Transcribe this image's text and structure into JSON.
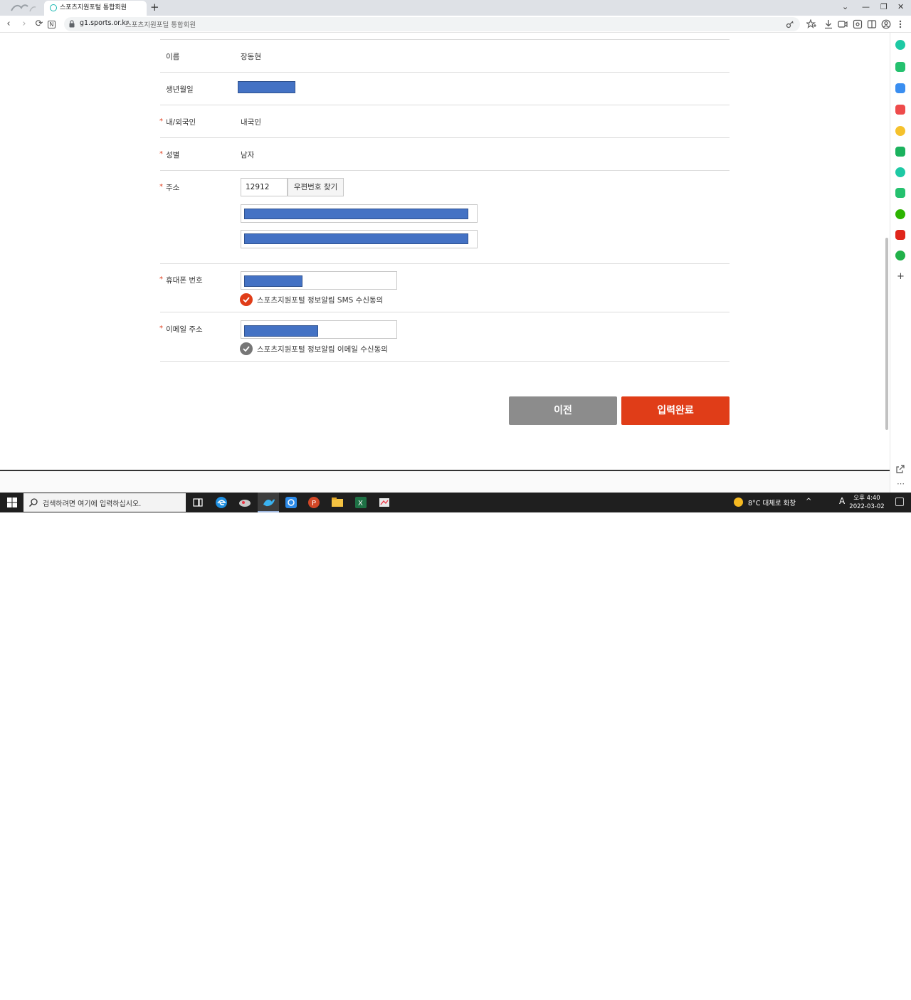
{
  "browser": {
    "tab_title": "스포츠지원포털 통합회원",
    "tab_close": "×",
    "new_tab": "+",
    "url_host": "g1.sports.or.kr",
    "url_title": "스포츠지원포털 통합회원",
    "window_controls": [
      "⌄",
      "—",
      "❐",
      "✕"
    ],
    "nav": {
      "back": "‹",
      "forward": "›",
      "reload": "⟳",
      "n_badge": "N"
    }
  },
  "form": {
    "rows": [
      {
        "label": "이름",
        "required": false,
        "value": "장동현"
      },
      {
        "label": "생년월일",
        "required": false,
        "value": ""
      },
      {
        "label": "내/외국인",
        "required": true,
        "value": "내국인"
      },
      {
        "label": "성별",
        "required": true,
        "value": "남자"
      },
      {
        "label": "주소",
        "required": true,
        "value": ""
      },
      {
        "label": "휴대폰 번호",
        "required": true,
        "value": ""
      },
      {
        "label": "이메일 주소",
        "required": true,
        "value": ""
      }
    ],
    "required_mark": "*",
    "zipcode": "12912",
    "zip_button": "우편번호 찾기",
    "sms_consent": "스포츠지원포털 정보알림 SMS 수신동의",
    "email_consent": "스포츠지원포털 정보알림 이메일 수신동의",
    "sms_checked": true,
    "email_checked": false,
    "checked_color": "#e03d18",
    "unchecked_color": "#767676"
  },
  "buttons": {
    "prev": "이전",
    "submit": "입력완료"
  },
  "taskbar": {
    "search_placeholder": "검색하려면 여기에 입력하십시오.",
    "weather": "8°C  대체로 화창",
    "ime": "A",
    "time": "오후 4:40",
    "date": "2022-03-02"
  },
  "colors": {
    "accent": "#e03d18",
    "secondary": "#8c8c8c",
    "redaction": "#4472c4"
  }
}
